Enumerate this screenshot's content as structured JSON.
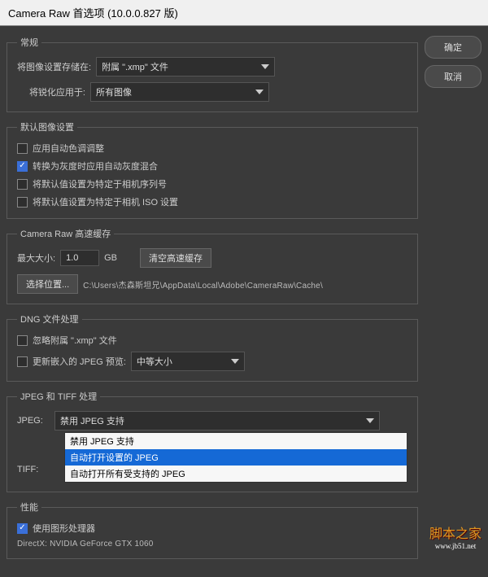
{
  "title": "Camera Raw 首选项  (10.0.0.827 版)",
  "buttons": {
    "ok": "确定",
    "cancel": "取消"
  },
  "general": {
    "legend": "常规",
    "saveLabel": "将图像设置存储在:",
    "saveValue": "附属 \".xmp\" 文件",
    "sharpenLabel": "将锐化应用于:",
    "sharpenValue": "所有图像"
  },
  "defaults": {
    "legend": "默认图像设置",
    "opts": [
      {
        "label": "应用自动色调调整",
        "checked": false
      },
      {
        "label": "转换为灰度时应用自动灰度混合",
        "checked": true
      },
      {
        "label": "将默认值设置为特定于相机序列号",
        "checked": false
      },
      {
        "label": "将默认值设置为特定于相机 ISO 设置",
        "checked": false
      }
    ]
  },
  "cache": {
    "legend": "Camera Raw 高速缓存",
    "maxLabel": "最大大小:",
    "maxValue": "1.0",
    "unit": "GB",
    "purgeBtn": "清空高速缓存",
    "locBtn": "选择位置...",
    "path": "C:\\Users\\杰森斯坦兄\\AppData\\Local\\Adobe\\CameraRaw\\Cache\\"
  },
  "dng": {
    "legend": "DNG 文件处理",
    "ignoreLabel": "忽略附属 \".xmp\" 文件",
    "updateLabel": "更新嵌入的 JPEG 预览:",
    "updateValue": "中等大小"
  },
  "jpegTiff": {
    "legend": "JPEG 和 TIFF 处理",
    "jpegLabel": "JPEG:",
    "jpegValue": "禁用 JPEG 支持",
    "tiffLabel": "TIFF:",
    "options": [
      "禁用 JPEG 支持",
      "自动打开设置的 JPEG",
      "自动打开所有受支持的 JPEG"
    ]
  },
  "perf": {
    "legend": "性能",
    "gpuLabel": "使用图形处理器",
    "gpuInfo": "DirectX: NVIDIA GeForce GTX 1060"
  },
  "watermark": {
    "text": "脚本之家",
    "url": "www.jb51.net"
  }
}
